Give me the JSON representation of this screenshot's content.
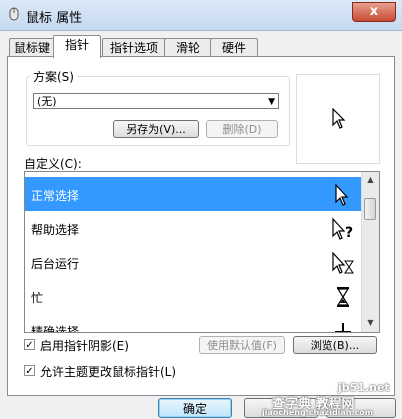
{
  "window": {
    "title": "鼠标 属性",
    "close_glyph": "x"
  },
  "tabs": [
    {
      "label": "鼠标键"
    },
    {
      "label": "指针"
    },
    {
      "label": "指针选项"
    },
    {
      "label": "滑轮"
    },
    {
      "label": "硬件"
    }
  ],
  "scheme": {
    "legend": "方案(S)",
    "value": "(无)",
    "save_as_label": "另存为(V)...",
    "delete_label": "删除(D)"
  },
  "custom": {
    "label": "自定义(C):",
    "items": [
      {
        "label": "正常选择",
        "cursor_icon": "arrow-cursor-icon",
        "selected": true
      },
      {
        "label": "帮助选择",
        "cursor_icon": "help-cursor-icon",
        "selected": false
      },
      {
        "label": "后台运行",
        "cursor_icon": "working-in-background-cursor-icon",
        "selected": false
      },
      {
        "label": "忙",
        "cursor_icon": "hourglass-cursor-icon",
        "selected": false
      },
      {
        "label": "精确选择",
        "cursor_icon": "precision-cursor-icon",
        "selected": false
      }
    ]
  },
  "options": {
    "shadow_label": "启用指针阴影(E)",
    "shadow_checked": true,
    "use_default_label": "使用默认值(F)",
    "browse_label": "浏览(B)...",
    "theme_label": "允许主题更改鼠标指针(L)",
    "theme_checked": true
  },
  "footer": {
    "ok_label": "确定"
  },
  "watermark": {
    "line1": "jb51.net",
    "line2": "查字典 教程网",
    "line3": "jiaocheng.chazidian.com"
  },
  "colors": {
    "selection": "#3399ff",
    "tab_border": "#898c95"
  }
}
